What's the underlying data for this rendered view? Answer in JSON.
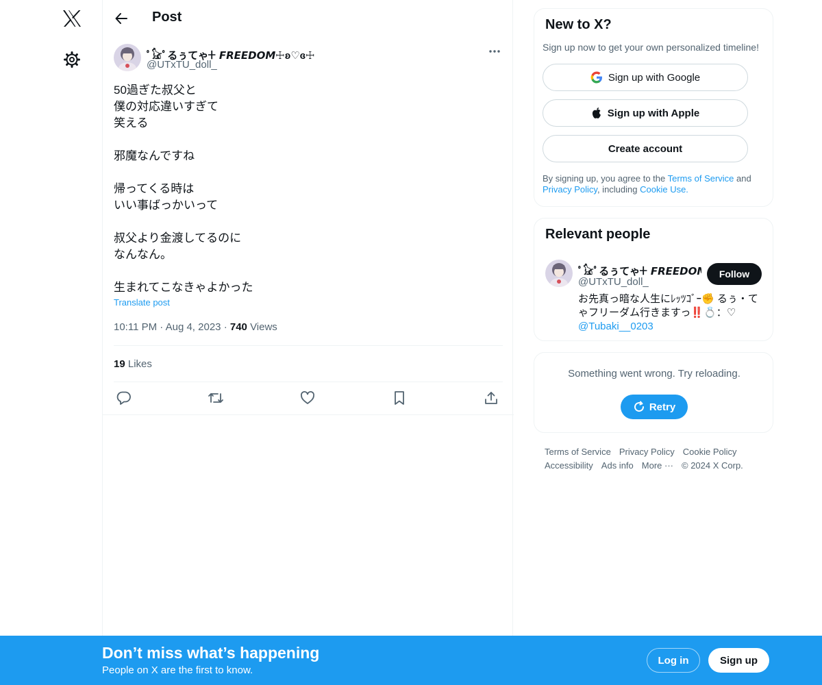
{
  "colors": {
    "accent": "#1d9bf0",
    "text": "#0f1419",
    "muted": "#536471",
    "border": "#eff3f4"
  },
  "nav": {
    "logo_icon": "x-logo-icon",
    "settings_icon": "gear-icon"
  },
  "header": {
    "title": "Post",
    "back_icon": "arrow-left-icon"
  },
  "tweet": {
    "author": {
      "name": "ﾟ𓃠ﾟるぅてゃ𐊛 𝙁𝙍𝙀𝙀𝘿𝙊𝙈☩ʚ♡ɞ☩",
      "handle": "@UTxTU_doll_"
    },
    "lines": [
      "50過ぎた叔父と",
      "僕の対応違いすぎて",
      "笑える",
      "",
      "邪魔なんですね",
      "",
      "帰ってくる時は",
      "いい事ばっかいって",
      "",
      "叔父より金渡してるのに",
      "なんなん。",
      "",
      "生まれてこなきゃよかった"
    ],
    "translate_label": "Translate post",
    "time": "10:11 PM",
    "date": "Aug 4, 2023",
    "views_count": "740",
    "views_label": "Views",
    "likes_count": "19",
    "likes_label": "Likes"
  },
  "signup_card": {
    "title": "New to X?",
    "subtitle": "Sign up now to get your own personalized timeline!",
    "google_label": "Sign up with Google",
    "apple_label": "Sign up with Apple",
    "create_label": "Create account",
    "legal_prefix": "By signing up, you agree to the ",
    "terms_link": "Terms of Service",
    "legal_and": " and ",
    "privacy_link": "Privacy Policy",
    "legal_including": ", including ",
    "cookie_link": "Cookie Use."
  },
  "people_card": {
    "title": "Relevant people",
    "name": "ﾟ𓃠ﾟるぅてゃ𐊛 𝙁𝙍𝙀𝙀𝘿𝙊𝙈☩",
    "handle": "@UTxTU_doll_",
    "follow_label": "Follow",
    "bio": "お先真っ暗な人生にﾚｯﾂｺﾞｰ✊ るぅ・てゃフリーダム行きますっ‼️💍：♡",
    "mention": "@Tubaki__0203"
  },
  "error_card": {
    "message": "Something went wrong. Try reloading.",
    "retry_label": "Retry"
  },
  "footer": {
    "terms": "Terms of Service",
    "privacy": "Privacy Policy",
    "cookie": "Cookie Policy",
    "accessibility": "Accessibility",
    "ads": "Ads info",
    "more": "More ···",
    "copyright": "© 2024 X Corp."
  },
  "banner": {
    "title": "Don’t miss what’s happening",
    "subtitle": "People on X are the first to know.",
    "login_label": "Log in",
    "signup_label": "Sign up"
  }
}
